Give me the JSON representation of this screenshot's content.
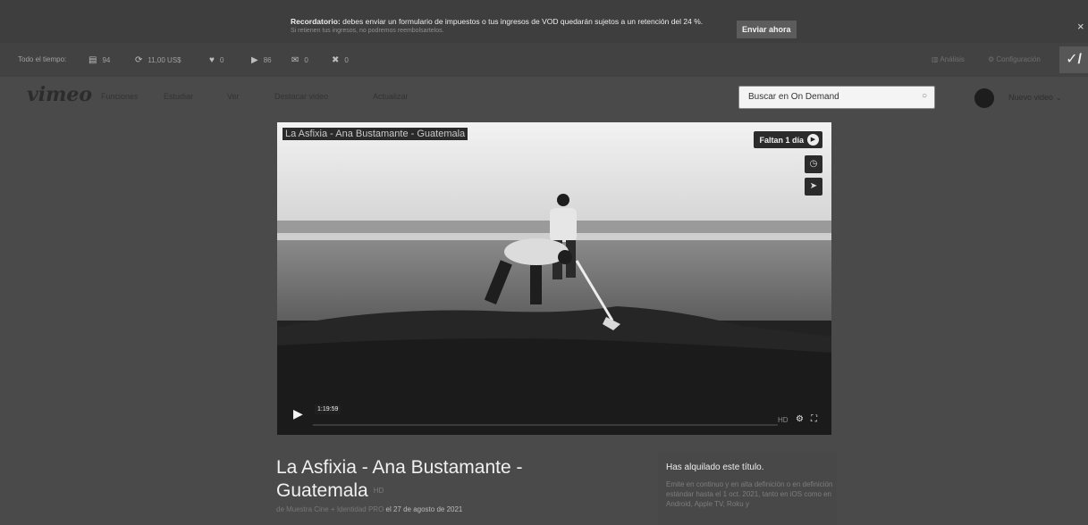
{
  "notice": {
    "bold": "Recordatorio:",
    "text": " debes enviar un formulario de impuestos o tus ingresos de VOD quedarán sujetos a un retención del 24 %.",
    "subtext": "Si retienen tus ingresos, no podremos reembolsartelos.",
    "button": "Enviar ahora",
    "close": "×"
  },
  "stats": {
    "period": "Todo el tiempo:",
    "items": [
      {
        "icon": "document-icon",
        "glyph": "▤",
        "value": "94"
      },
      {
        "icon": "earnings-icon",
        "glyph": "⟳",
        "value": "11,00 US$"
      },
      {
        "icon": "heart-icon",
        "glyph": "♥",
        "value": "0"
      },
      {
        "icon": "play-icon",
        "glyph": "▶",
        "value": "86"
      },
      {
        "icon": "comment-icon",
        "glyph": "✉",
        "value": "0"
      },
      {
        "icon": "rating-icon",
        "glyph": "✖",
        "value": "0"
      }
    ],
    "analytics": "Análisis",
    "settings": "Configuración"
  },
  "brand_mark": "✓/",
  "nav": {
    "logo": "vimeo",
    "items": [
      "Funciones",
      "Estudiar",
      "Ver",
      "Destacar video",
      "Actualizar"
    ],
    "search_placeholder": "Buscar en On Demand",
    "new_video": "Nuevo video ⌄"
  },
  "player": {
    "title": "La Asfixia - Ana Bustamante - Guatemala",
    "countdown": "Faltan 1 día",
    "timecode": "1:19:59"
  },
  "details": {
    "title": "La Asfixia - Ana Bustamante - Guatemala",
    "badge": "HD",
    "byline_prefix": "de Muestra Cine + Identidad ",
    "byline_owner": "PRO",
    "byline_date": " el 27 de agosto de 2021"
  },
  "rental": {
    "title": "Has alquilado este título.",
    "body": "Emite en continuo y en alta definición o en definición estándar hasta el 1 oct. 2021, tanto en iOS como en Android, Apple TV, Roku y"
  }
}
